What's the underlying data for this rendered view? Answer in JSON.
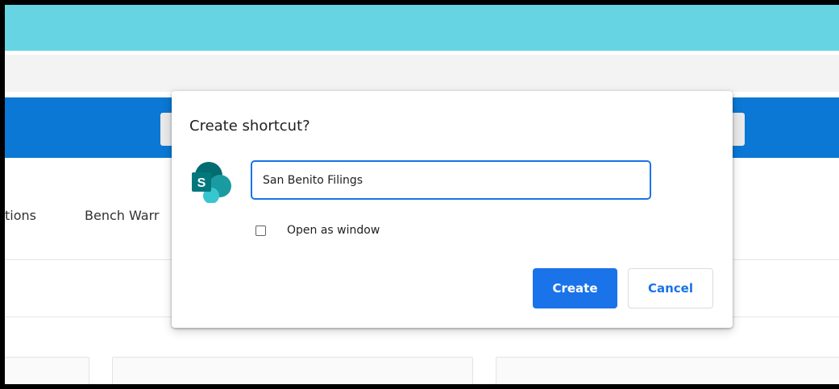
{
  "background": {
    "nav_items": [
      "tions",
      "Bench Warr"
    ]
  },
  "dialog": {
    "title": "Create shortcut?",
    "app_icon": "sharepoint-icon",
    "name_input": {
      "value": "San Benito Filings",
      "placeholder": ""
    },
    "open_as_window": {
      "label": "Open as window",
      "checked": false
    },
    "create_label": "Create",
    "cancel_label": "Cancel"
  },
  "colors": {
    "accent": "#1a73e8",
    "top_band": "#67d4e3",
    "blue_band": "#0a78d4",
    "sharepoint_dark": "#036c70",
    "sharepoint_mid": "#1a9ba1",
    "sharepoint_light": "#37c6d0"
  }
}
